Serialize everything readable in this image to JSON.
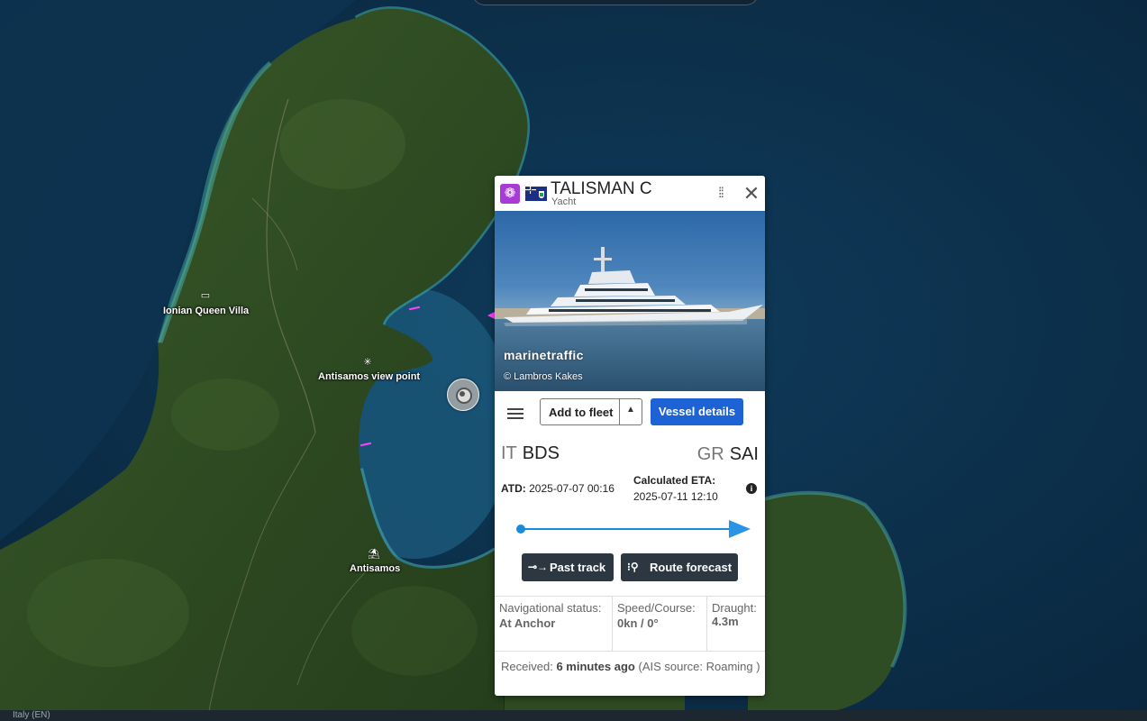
{
  "map": {
    "pois": [
      {
        "name": "Ionian Queen Villa",
        "icon": "hotel-icon"
      },
      {
        "name": "Antisamos view point",
        "icon": "viewpoint-icon"
      },
      {
        "name": "Antisamos",
        "icon": "beach-icon"
      }
    ],
    "bottom_text": "Italy (EN)"
  },
  "popup": {
    "vessel_name": "TALISMAN C",
    "vessel_type": "Yacht",
    "type_icon": "yacht-type-icon",
    "flag": "cayman-islands-flag",
    "photo": {
      "watermark": "marinetraffic",
      "credit": "© Lambros Kakes"
    },
    "actions": {
      "add_to_fleet": "Add to fleet",
      "vessel_details": "Vessel details"
    },
    "voyage": {
      "departure_country": "IT",
      "departure_port": "BDS",
      "arrival_country": "GR",
      "arrival_port": "SAI",
      "atd_label": "ATD:",
      "atd_value": "2025-07-07 00:16",
      "eta_label": "Calculated ETA:",
      "eta_value": "2025-07-11 12:10",
      "progress": 1.0,
      "past_track": "Past track",
      "route_forecast": "Route forecast"
    },
    "stats": {
      "nav_label": "Navigational status:",
      "nav_value": "At Anchor",
      "speed_label": "Speed/Course:",
      "speed_value": "0kn / 0°",
      "draught_label": "Draught:",
      "draught_value": "4.3m"
    },
    "received": {
      "label": "Received:",
      "age": "6 minutes ago",
      "source": "(AIS source: Roaming )"
    },
    "colors": {
      "type_badge": "#a63bd5",
      "primary_button": "#1d63d6",
      "progress": "#1b8ad9",
      "dark_button": "#2c3741"
    }
  }
}
